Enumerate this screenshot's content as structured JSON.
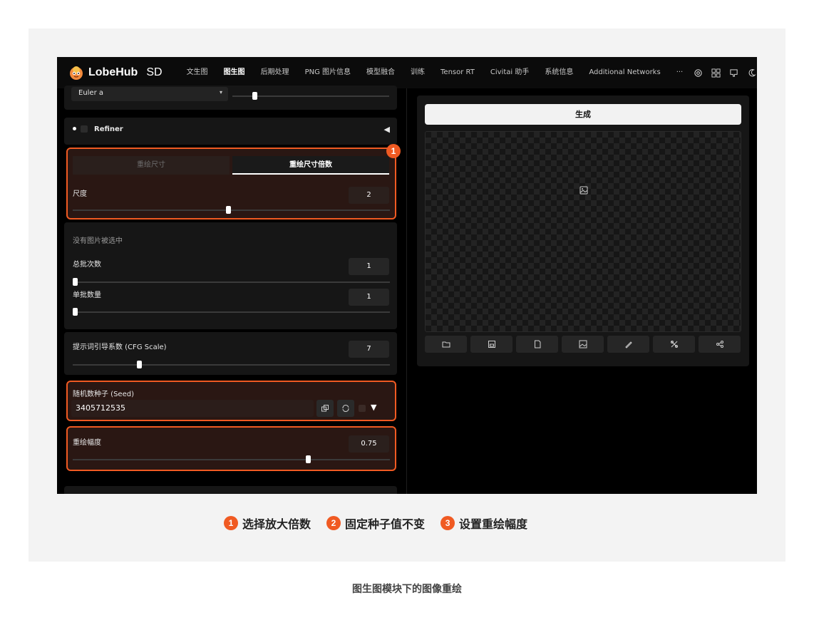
{
  "app": {
    "brand_name": "LobeHub",
    "brand_suffix": "SD"
  },
  "nav": {
    "tabs": [
      {
        "label": "文生图",
        "active": false
      },
      {
        "label": "图生图",
        "active": true
      },
      {
        "label": "后期处理",
        "active": false
      },
      {
        "label": "PNG 图片信息",
        "active": false
      },
      {
        "label": "模型融合",
        "active": false
      },
      {
        "label": "训练",
        "active": false
      },
      {
        "label": "Tensor RT",
        "active": false
      },
      {
        "label": "Civitai 助手",
        "active": false
      },
      {
        "label": "系统信息",
        "active": false
      },
      {
        "label": "Additional Networks",
        "active": false
      }
    ],
    "more": "···",
    "icons": [
      "openai-icon",
      "grid-icon",
      "github-icon",
      "moon-icon",
      "settings-icon"
    ]
  },
  "left": {
    "sampler": {
      "value": "Euler a"
    },
    "refiner": {
      "label": "Refiner",
      "toggle": "◀"
    },
    "resize": {
      "mode_tabs": [
        {
          "label": "重绘尺寸",
          "active": false
        },
        {
          "label": "重绘尺寸倍数",
          "active": true
        }
      ],
      "scale_label": "尺度",
      "scale_value": "2",
      "scale_fraction": 0.5
    },
    "no_image_text": "没有图片被选中",
    "batch_count": {
      "label": "总批次数",
      "value": "1",
      "fraction": 0.0
    },
    "batch_size": {
      "label": "单批数量",
      "value": "1",
      "fraction": 0.0
    },
    "cfg": {
      "label": "提示词引导系数 (CFG Scale)",
      "value": "7",
      "fraction": 0.2
    },
    "seed": {
      "label": "随机数种子 (Seed)",
      "value": "3405712535",
      "toggle": "▼"
    },
    "denoise": {
      "label": "重绘幅度",
      "value": "0.75",
      "fraction": 0.75
    }
  },
  "right": {
    "generate_label": "生成",
    "tool_icons": [
      "folder-icon",
      "save-icon",
      "zip-icon",
      "image-icon",
      "brush-icon",
      "extras-icon",
      "share-icon"
    ]
  },
  "annotations": {
    "markers": [
      "1"
    ],
    "captions": [
      {
        "num": "1",
        "text": "选择放大倍数"
      },
      {
        "num": "2",
        "text": "固定种子值不变"
      },
      {
        "num": "3",
        "text": "设置重绘幅度"
      }
    ],
    "figure_caption": "图生图模块下的图像重绘"
  },
  "colors": {
    "accent": "#f05a22",
    "panel": "#161616",
    "background": "#000000"
  }
}
